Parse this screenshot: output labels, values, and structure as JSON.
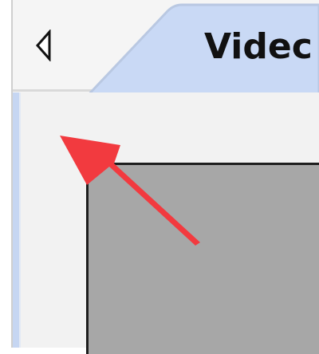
{
  "tabs": {
    "active_label": "Videc"
  },
  "icons": {
    "scroll_left": "triangle-left-icon",
    "pointer": "red-arrow-annotation"
  },
  "colors": {
    "active_tab_fill": "#c9d9f5",
    "active_tab_border": "#b9c8e2",
    "content_panel": "#f2f2f2",
    "panel_accent": "#c6d6f2",
    "video_preview": "#a7a7a7",
    "annotation_arrow": "#f23a3f"
  }
}
